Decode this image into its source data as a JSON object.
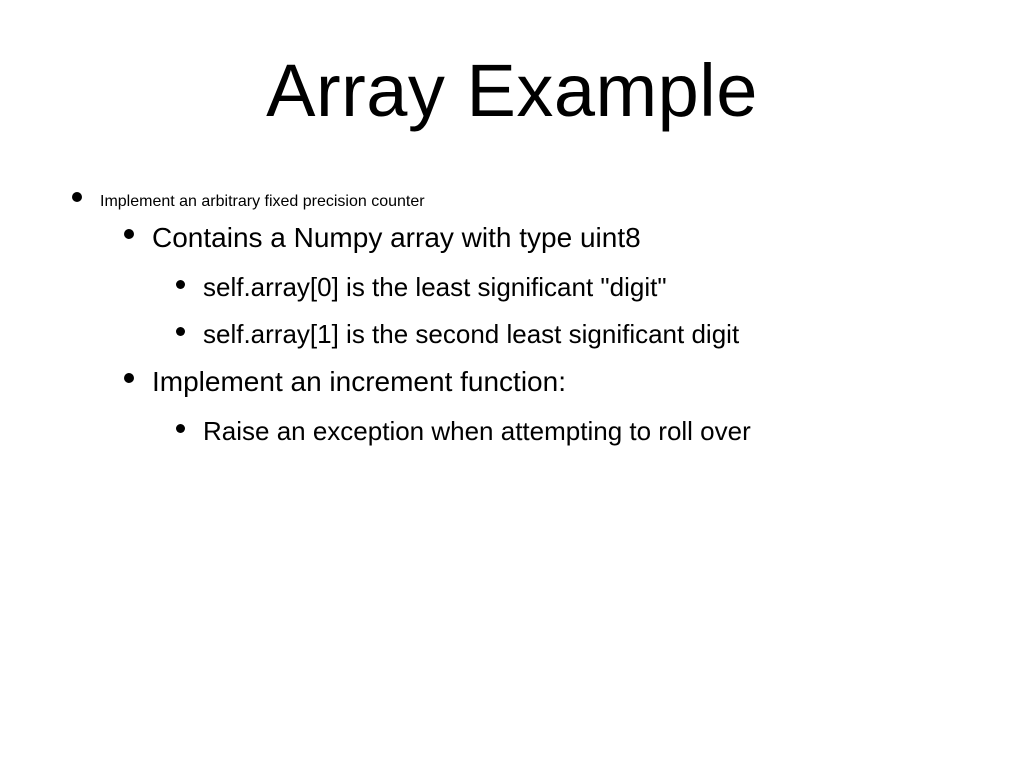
{
  "title": "Array Example",
  "bullets": {
    "l1_1": "Implement an arbitrary fixed precision counter",
    "l2_1": "Contains a Numpy array with type uint8",
    "l3_1": "self.array[0] is the least significant \"digit\"",
    "l3_2": "self.array[1] is the second least significant digit",
    "l2_2": "Implement an increment function:",
    "l3_3": "Raise an exception when attempting to roll over"
  }
}
